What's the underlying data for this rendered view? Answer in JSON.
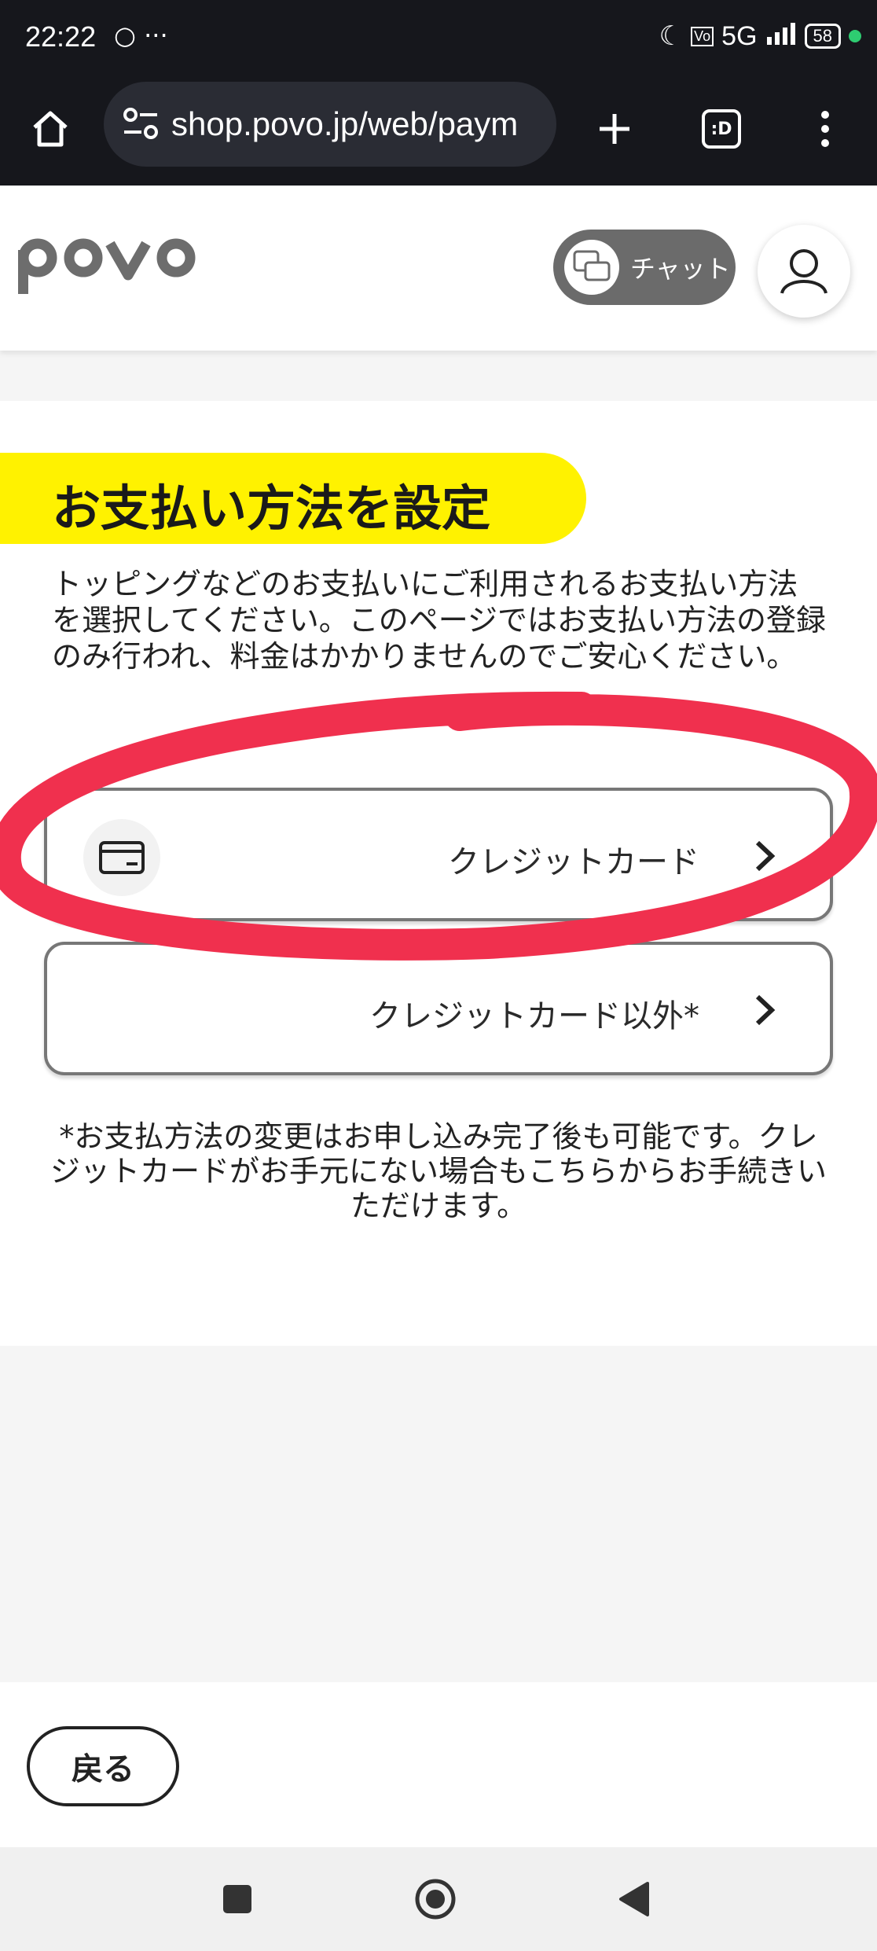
{
  "status_bar": {
    "time": "22:22",
    "more": "···",
    "network": "5G",
    "battery": "58"
  },
  "browser": {
    "url": "shop.povo.jp/web/paym",
    "tab_count": ":D"
  },
  "header": {
    "logo": "povo",
    "chat_label": "チャット"
  },
  "main": {
    "title": "お支払い方法を設定",
    "description": "トッピングなどのお支払いにご利用されるお支払い方法を選択してください。このページではお支払い方法の登録のみ行われ、料金はかかりませんのでご安心ください。",
    "options": [
      {
        "label": "クレジットカード",
        "icon": "credit-card-icon"
      },
      {
        "label": "クレジットカード以外*"
      }
    ],
    "note": "*お支払方法の変更はお申し込み完了後も可能です。クレジットカードがお手元にない場合もこちらからお手続きいただけます。"
  },
  "footer": {
    "back_label": "戻る"
  },
  "colors": {
    "accent_yellow": "#fff200",
    "annotation_red": "#f0304e",
    "dark_bar": "#16171c"
  }
}
